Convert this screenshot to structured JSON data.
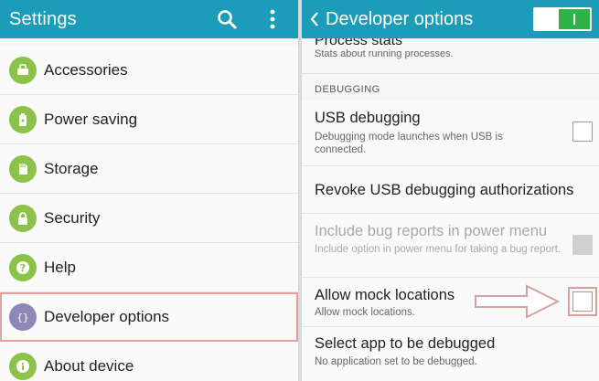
{
  "left": {
    "title": "Settings",
    "icons": {
      "search": "search-icon",
      "menu": "more-vert-icon"
    },
    "items": [
      {
        "label": "Accessories",
        "icon": "accessories-icon"
      },
      {
        "label": "Power saving",
        "icon": "battery-icon"
      },
      {
        "label": "Storage",
        "icon": "storage-icon"
      },
      {
        "label": "Security",
        "icon": "lock-icon"
      },
      {
        "label": "Help",
        "icon": "help-icon"
      },
      {
        "label": "Developer options",
        "icon": "braces-icon"
      },
      {
        "label": "About device",
        "icon": "info-icon"
      }
    ]
  },
  "right": {
    "title": "Developer options",
    "master_switch": "on",
    "process_stats": {
      "title": "Process stats",
      "summary": "Stats about running processes."
    },
    "section": "DEBUGGING",
    "rows": [
      {
        "title": "USB debugging",
        "summary": "Debugging mode launches when USB is connected.",
        "checked": false,
        "enabled": true
      },
      {
        "title": "Revoke USB debugging authorizations",
        "summary": "",
        "enabled": true
      },
      {
        "title": "Include bug reports in power menu",
        "summary": "Include option in power menu for taking a bug report.",
        "checked": false,
        "enabled": false
      },
      {
        "title": "Allow mock locations",
        "summary": "Allow mock locations.",
        "checked": false,
        "enabled": true
      },
      {
        "title": "Select app to be debugged",
        "summary": "No application set to be debugged.",
        "enabled": true
      }
    ]
  },
  "colors": {
    "appbar": "#1b9cb8",
    "green_icon": "#8bc34a",
    "dev_icon": "#8e86b7",
    "switch_on": "#2fb24a",
    "annotation": "#d9a0a0"
  }
}
